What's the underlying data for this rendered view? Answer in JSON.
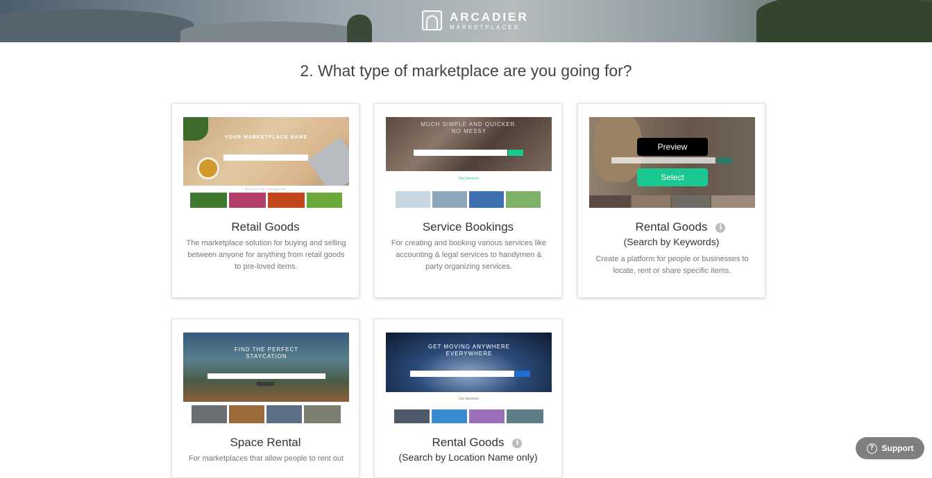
{
  "header": {
    "logo_title": "ARCADIER",
    "logo_subtitle": "MARKETPLACES"
  },
  "page": {
    "heading": "2. What type of marketplace are you going for?"
  },
  "cards": [
    {
      "title": "Retail Goods",
      "subtitle": "",
      "description": "The marketplace solution for buying and selling between anyone for anything from retail goods to pre-loved items.",
      "thumbnail": {
        "banner_text": "YOUR MARKETPLACE NAME",
        "section_text": "Browse by Categories"
      },
      "has_info_icon": false
    },
    {
      "title": "Service Bookings",
      "subtitle": "",
      "description": "For creating and booking various services like accounting & legal services to handymen & party organizing services.",
      "thumbnail": {
        "banner_text": "MUCH SIMPLE AND QUICKER. NO MESSY",
        "section_text": "Our Services"
      },
      "has_info_icon": false
    },
    {
      "title": "Rental Goods",
      "subtitle": "(Search by Keywords)",
      "description": "Create a platform for people or businesses to locate, rent or share specific items.",
      "thumbnail": {
        "banner_text": "",
        "section_text": ""
      },
      "has_info_icon": true,
      "hover_buttons": {
        "preview_label": "Preview",
        "select_label": "Select"
      }
    },
    {
      "title": "Space Rental",
      "subtitle": "",
      "description": "For marketplaces that allow people to rent out",
      "thumbnail": {
        "banner_text": "FIND THE PERFECT STAYCATION",
        "section_text": ""
      },
      "has_info_icon": false
    },
    {
      "title": "Rental Goods",
      "subtitle": "(Search by Location Name only)",
      "description": "",
      "thumbnail": {
        "banner_text": "GET MOVING ANYWHERE EVERYWHERE",
        "section_text": "Our Services"
      },
      "has_info_icon": true
    }
  ],
  "icons": {
    "info": "i",
    "help": "?"
  },
  "support": {
    "label": "Support"
  },
  "colors": {
    "select_button": "#19c98f",
    "preview_button": "#000000",
    "support_button": "#7f7f7f"
  }
}
